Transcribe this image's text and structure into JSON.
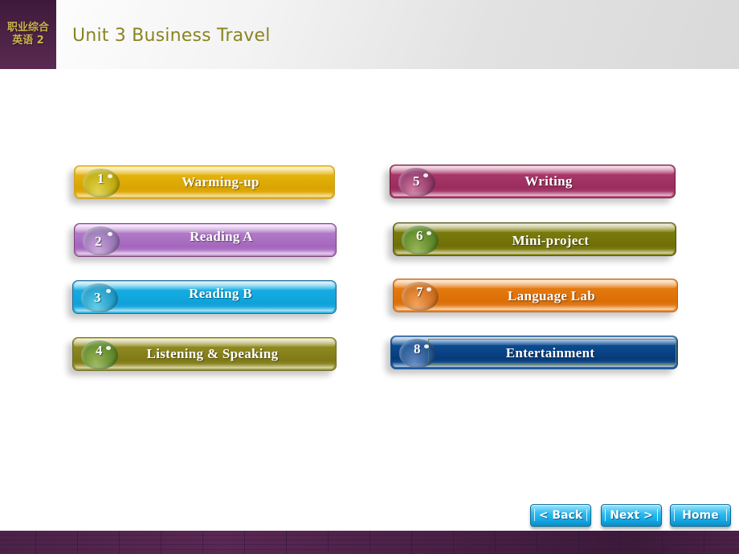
{
  "header": {
    "logo_line1": "职业综合",
    "logo_line2": "英语 2",
    "title": "Unit 3 Business Travel"
  },
  "menu": [
    {
      "number": "1",
      "label": "Warming-up",
      "color": "#d9a300"
    },
    {
      "number": "2",
      "label": "Reading  A",
      "color": "#a466bd"
    },
    {
      "number": "3",
      "label": "Reading  B",
      "color": "#0ea1d8"
    },
    {
      "number": "4",
      "label": "Listening  & Speaking",
      "color": "#7f7a17"
    },
    {
      "number": "5",
      "label": "Writing",
      "color": "#9a2c5e"
    },
    {
      "number": "6",
      "label": "Mini-project",
      "color": "#6f6f05"
    },
    {
      "number": "7",
      "label": "Language  Lab",
      "color": "#db6e05"
    },
    {
      "number": "8",
      "label": "Entertainment",
      "color": "#063b7a"
    }
  ],
  "nav": {
    "back": "< Back",
    "next": "Next >",
    "home": "Home",
    "color": "#12a6e2"
  },
  "theme": {
    "brand_purple": "#4f2348",
    "title_color": "#8a8420"
  }
}
